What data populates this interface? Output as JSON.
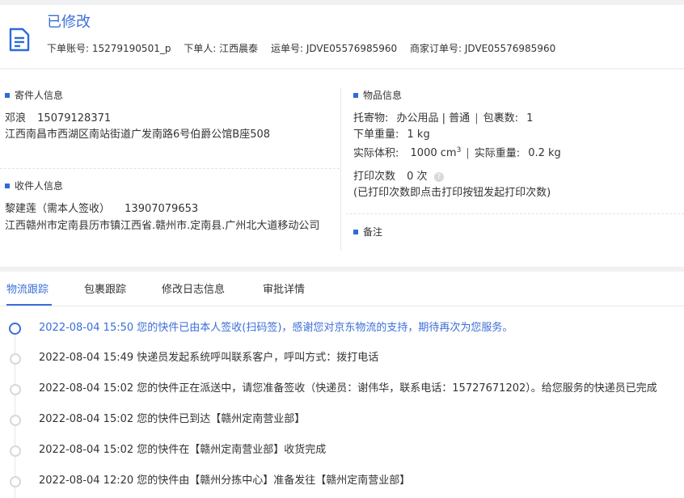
{
  "header": {
    "status": "已修改",
    "meta": [
      "下单账号: 15279190501_p",
      "下单人: 江西晨泰",
      "运单号: JDVE05576985960",
      "商家订单号: JDVE05576985960"
    ]
  },
  "sender": {
    "title": "寄件人信息",
    "name": "邓浪",
    "phone": "15079128371",
    "address": "江西南昌市西湖区南站街道广发南路6号伯爵公馆B座508"
  },
  "receiver": {
    "title": "收件人信息",
    "name": "黎建莲（需本人签收）",
    "phone": "13907079653",
    "address": "江西赣州市定南县历市镇江西省.赣州市.定南县.广州北大道移动公司"
  },
  "goods": {
    "title": "物品信息",
    "item_label": "托寄物:",
    "item_value": "办公用品 | 普通",
    "packages_label": "包裹数:",
    "packages_value": "1",
    "order_weight_label": "下单重量:",
    "order_weight_value": "1 kg",
    "volume_label": "实际体积:",
    "volume_value": "1000 cm",
    "volume_sup": "3",
    "actual_weight_label": "实际重量:",
    "actual_weight_value": "0.2 kg",
    "print_label": "打印次数",
    "print_value": "0 次",
    "print_note": "(已打印次数即点击打印按钮发起打印次数)"
  },
  "remark": {
    "title": "备注"
  },
  "tabs": [
    "物流跟踪",
    "包裹跟踪",
    "修改日志信息",
    "审批详情"
  ],
  "timeline": [
    "2022-08-04 15:50 您的快件已由本人签收(扫码签)，感谢您对京东物流的支持，期待再次为您服务。",
    "2022-08-04 15:49 快递员发起系统呼叫联系客户，呼叫方式：拨打电话",
    "2022-08-04 15:02 您的快件正在派送中，请您准备签收（快递员：谢伟华，联系电话：15727671202）。给您服务的快递员已完成",
    "2022-08-04 15:02 您的快件已到达【赣州定南营业部】",
    "2022-08-04 15:02 您的快件在【赣州定南营业部】收货完成",
    "2022-08-04 12:20 您的快件由【赣州分拣中心】准备发往【赣州定南营业部】"
  ],
  "colors": {
    "accent": "#3b6ed8",
    "marker": "#2c6bdb",
    "background": "#f0f1f3"
  }
}
